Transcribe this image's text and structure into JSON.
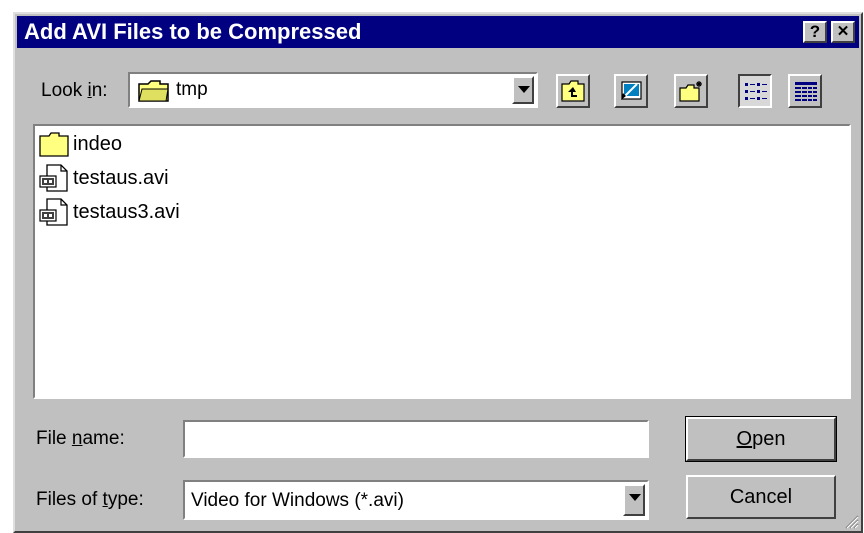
{
  "window": {
    "title": "Add AVI Files to be Compressed",
    "help_button": "?",
    "close_button": "✕"
  },
  "lookin": {
    "label_pre": "Look ",
    "label_hot": "i",
    "label_post": "n:",
    "value": "tmp"
  },
  "toolbar": {
    "buttons": [
      "up-one-level",
      "desktop",
      "create-new-folder",
      "list-view",
      "details-view"
    ],
    "pressed": "list-view"
  },
  "files": [
    {
      "name": "indeo",
      "type": "folder"
    },
    {
      "name": "testaus.avi",
      "type": "avi"
    },
    {
      "name": "testaus3.avi",
      "type": "avi"
    }
  ],
  "filename": {
    "label_pre": "File ",
    "label_hot": "n",
    "label_post": "ame:",
    "value": ""
  },
  "filetype": {
    "label_pre": "Files of ",
    "label_hot": "t",
    "label_post": "ype:",
    "value": "Video for Windows (*.avi)"
  },
  "buttons": {
    "open_hot": "O",
    "open_rest": "pen",
    "cancel": "Cancel"
  }
}
